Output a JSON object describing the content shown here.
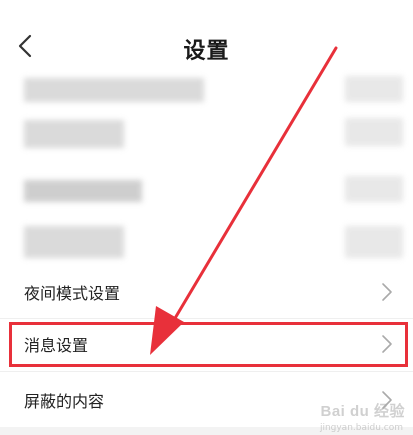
{
  "header": {
    "title": "设置",
    "back_icon": "chevron-left-icon"
  },
  "settings": {
    "items": [
      {
        "label": "夜间模式设置",
        "icon": "chevron-right-icon"
      },
      {
        "label": "消息设置",
        "icon": "chevron-right-icon"
      },
      {
        "label": "屏蔽的内容",
        "icon": "chevron-right-icon"
      }
    ]
  },
  "annotation": {
    "highlight_color": "#e8303a",
    "arrow_color": "#e8303a",
    "highlighted_item": "消息设置"
  },
  "watermark": {
    "brand": "Bai du 经验",
    "url": "jingyan.baidu.com"
  },
  "colors": {
    "background": "#ffffff",
    "text": "#222222",
    "chevron": "#aaaaaa"
  }
}
